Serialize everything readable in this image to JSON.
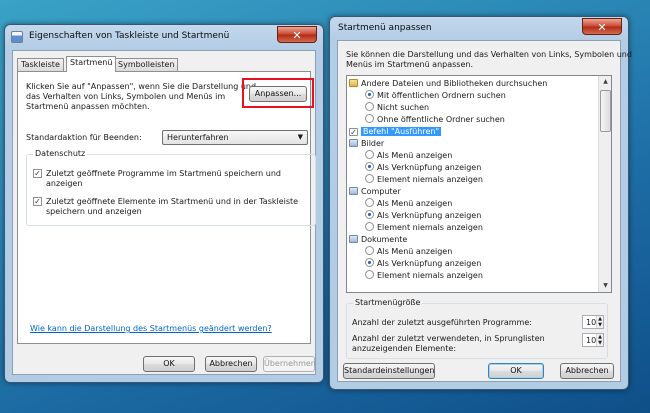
{
  "left_window": {
    "title": "Eigenschaften von Taskleiste und Startmenü",
    "close_glyph": "✕",
    "tabs": [
      "Taskleiste",
      "Startmenü",
      "Symbolleisten"
    ],
    "intro_text": [
      "Klicken Sie auf \"Anpassen\", wenn Sie die Darstellung und",
      "das Verhalten von Links, Symbolen und Menüs im",
      "Startmenü anpassen möchten."
    ],
    "customize_button": "Anpassen...",
    "power_action_label": "Standardaktion für Beenden:",
    "power_action_value": "Herunterfahren",
    "privacy_group": "Datenschutz",
    "privacy_options": [
      {
        "lines": [
          "Zuletzt geöffnete Programme im Startmenü speichern und",
          "anzeigen"
        ],
        "checked": true
      },
      {
        "lines": [
          "Zuletzt geöffnete Elemente im Startmenü und in der Taskleiste",
          "speichern und anzeigen"
        ],
        "checked": true
      }
    ],
    "help_link": "Wie kann die Darstellung des Startmenüs geändert werden?",
    "buttons": {
      "ok": "OK",
      "cancel": "Abbrechen",
      "apply": "Übernehmen"
    }
  },
  "right_window": {
    "title": "Startmenü anpassen",
    "close_glyph": "✕",
    "description": [
      "Sie können die Darstellung und das Verhalten von Links, Symbolen und",
      "Menüs im Startmenü anpassen."
    ],
    "tree_items": [
      {
        "text": "Andere Dateien und Bibliotheken durchsuchen",
        "kind": "header",
        "icon": "folder-icon"
      },
      {
        "text": "Mit öffentlichen Ordnern suchen",
        "kind": "radio",
        "checked": true
      },
      {
        "text": "Nicht suchen",
        "kind": "radio",
        "checked": false
      },
      {
        "text": "Ohne öffentliche Ordner suchen",
        "kind": "radio",
        "checked": false
      },
      {
        "text": "Befehl \"Ausführen\"",
        "kind": "check",
        "checked": true,
        "selected": true
      },
      {
        "text": "Bilder",
        "kind": "header",
        "icon": "pictures-icon"
      },
      {
        "text": "Als Menü anzeigen",
        "kind": "radio",
        "checked": false
      },
      {
        "text": "Als Verknüpfung anzeigen",
        "kind": "radio",
        "checked": true
      },
      {
        "text": "Element niemals anzeigen",
        "kind": "radio",
        "checked": false
      },
      {
        "text": "Computer",
        "kind": "header",
        "icon": "computer-icon"
      },
      {
        "text": "Als Menü anzeigen",
        "kind": "radio",
        "checked": false
      },
      {
        "text": "Als Verknüpfung anzeigen",
        "kind": "radio",
        "checked": true
      },
      {
        "text": "Element niemals anzeigen",
        "kind": "radio",
        "checked": false
      },
      {
        "text": "Dokumente",
        "kind": "header",
        "icon": "documents-icon"
      },
      {
        "text": "Als Menü anzeigen",
        "kind": "radio",
        "checked": false
      },
      {
        "text": "Als Verknüpfung anzeigen",
        "kind": "radio",
        "checked": true
      },
      {
        "text": "Element niemals anzeigen",
        "kind": "radio",
        "checked": false
      }
    ],
    "size_group": "Startmenügröße",
    "recent_programs_label": "Anzahl der zuletzt ausgeführten Programme:",
    "recent_programs_value": "10",
    "jumplist_label": [
      "Anzahl der zuletzt verwendeten, in Sprunglisten",
      "anzuzeigenden Elemente:"
    ],
    "jumplist_value": "10",
    "buttons": {
      "defaults": "Standardeinstellungen",
      "ok": "OK",
      "cancel": "Abbrechen"
    }
  },
  "colors": {
    "highlight_box": "#e81123",
    "selection": "#3399ff",
    "link": "#0066cc"
  }
}
